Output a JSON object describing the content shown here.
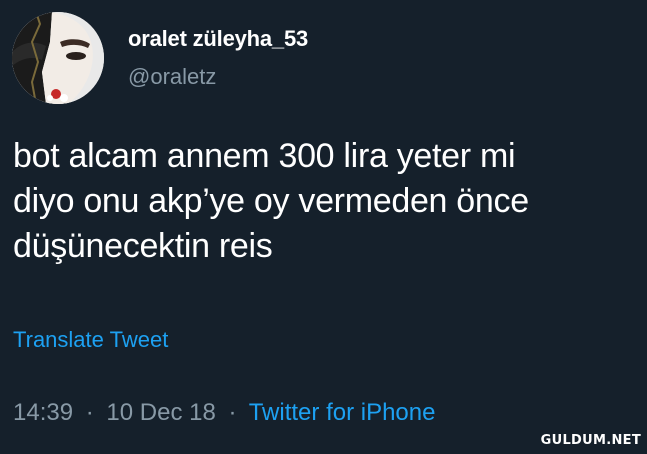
{
  "user": {
    "display_name": "oralet züleyha_53",
    "handle": "@oraletz"
  },
  "tweet": {
    "lines": [
      "bot alcam annem 300 lira yeter mi",
      "diyo onu akp’ye oy vermeden önce",
      "düşünecektin reis"
    ],
    "translate_label": "Translate Tweet",
    "time": "14:39",
    "date": "10 Dec 18",
    "separator": "·",
    "source": "Twitter for iPhone"
  },
  "watermark": "GULDUM.NET",
  "colors": {
    "background": "#15202b",
    "text": "#ffffff",
    "secondary": "#8899a6",
    "link": "#1da1f2"
  },
  "icons": {
    "avatar": "profile-photo-avatar"
  }
}
